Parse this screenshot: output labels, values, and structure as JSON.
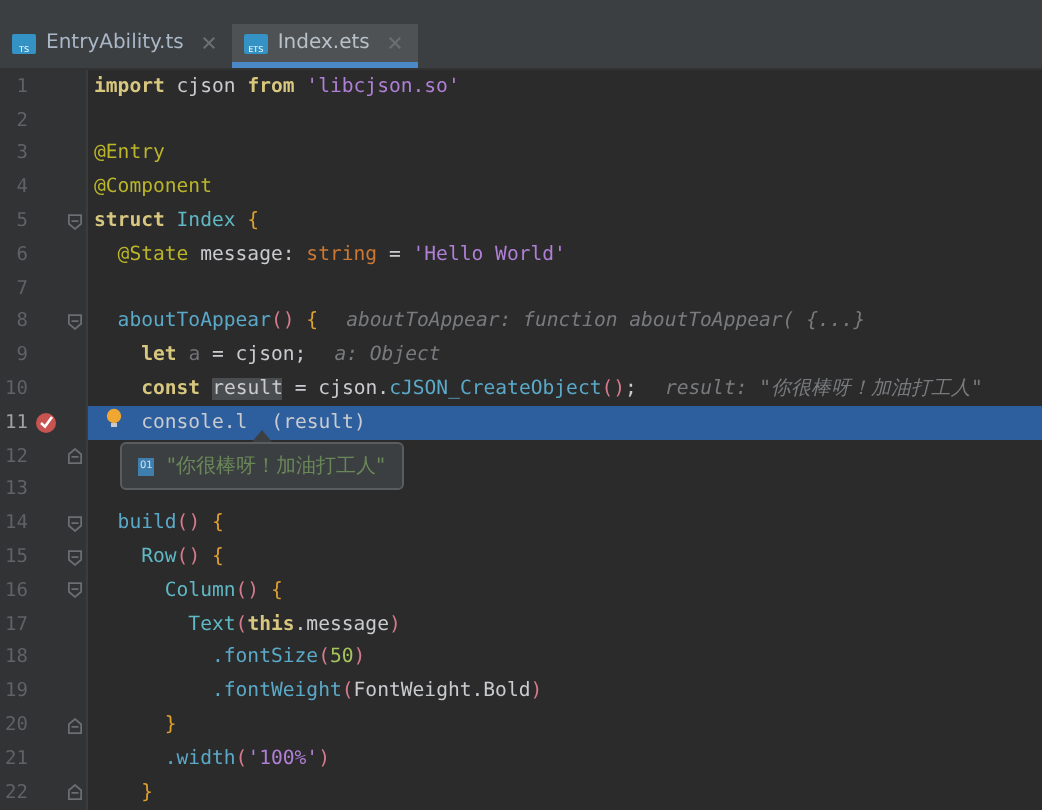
{
  "tabs": [
    {
      "label": "EntryAbility.ts",
      "icon": "TS",
      "selected": false
    },
    {
      "label": "Index.ets",
      "icon": "ETS",
      "selected": true
    }
  ],
  "lines": [
    {
      "number": "1",
      "tokens": [
        {
          "kind": "kw",
          "t": "import"
        },
        {
          "kind": "plain",
          "t": " cjson "
        },
        {
          "kind": "kw",
          "t": "from"
        },
        {
          "kind": "str",
          "t": " 'libcjson.so'"
        }
      ]
    },
    {
      "number": "2"
    },
    {
      "number": "3",
      "tokens": [
        {
          "kind": "dec",
          "t": "@Entry"
        }
      ]
    },
    {
      "number": "4",
      "tokens": [
        {
          "kind": "dec",
          "t": "@Component"
        }
      ]
    },
    {
      "number": "5",
      "fold_start": true,
      "tokens": [
        {
          "kind": "kw",
          "t": "struct"
        },
        {
          "kind": "cls",
          "t": " Index"
        },
        {
          "kind": "brace",
          "t": " {"
        }
      ]
    },
    {
      "number": "6",
      "tokens": [
        {
          "kind": "dec",
          "t": "  @State"
        },
        {
          "kind": "plain",
          "t": " message: "
        },
        {
          "kind": "type",
          "t": "string"
        },
        {
          "kind": "plain",
          "t": " = "
        },
        {
          "kind": "str",
          "t": "'Hello World'"
        }
      ]
    },
    {
      "number": "7"
    },
    {
      "number": "8",
      "fold_start": true,
      "tokens": [
        {
          "kind": "fn",
          "t": "  aboutToAppear"
        },
        {
          "kind": "paren",
          "t": "()"
        },
        {
          "kind": "brace",
          "t": " {"
        }
      ],
      "hint": "aboutToAppear: function aboutToAppear( {...}"
    },
    {
      "number": "9",
      "tokens": [
        {
          "kind": "kw",
          "t": "    let"
        },
        {
          "kind": "unused",
          "t": " a"
        },
        {
          "kind": "plain",
          "t": " = cjson;"
        }
      ],
      "hint": "a: Object"
    },
    {
      "number": "10",
      "tokens": [
        {
          "kind": "kw",
          "t": "    const"
        },
        {
          "kind": "mark",
          "t": "result"
        },
        {
          "kind": "plain",
          "t": " = cjson."
        },
        {
          "kind": "fn",
          "t": "cJSON_CreateObject"
        },
        {
          "kind": "paren",
          "t": "()"
        },
        {
          "kind": "plain",
          "t": ";"
        }
      ],
      "hint": "result: \"你很棒呀！加油打工人\""
    },
    {
      "number": "11",
      "current": true,
      "breakpoint": true,
      "bulb": true,
      "tokens": [
        {
          "kind": "plain",
          "t": "console.l"
        },
        {
          "kind": "plain",
          "t": "(result)",
          "spaced": true
        }
      ]
    },
    {
      "number": "12",
      "fold_end": true
    },
    {
      "number": "13"
    },
    {
      "number": "14",
      "fold_start": true,
      "tokens": [
        {
          "kind": "fn",
          "t": "  build"
        },
        {
          "kind": "paren",
          "t": "()"
        },
        {
          "kind": "brace",
          "t": " {"
        }
      ]
    },
    {
      "number": "15",
      "fold_start": true,
      "tokens": [
        {
          "kind": "cls",
          "t": "    Row"
        },
        {
          "kind": "paren",
          "t": "()"
        },
        {
          "kind": "brace",
          "t": " {"
        }
      ]
    },
    {
      "number": "16",
      "fold_start": true,
      "tokens": [
        {
          "kind": "cls",
          "t": "      Column"
        },
        {
          "kind": "paren",
          "t": "()"
        },
        {
          "kind": "brace",
          "t": " {"
        }
      ]
    },
    {
      "number": "17",
      "tokens": [
        {
          "kind": "cls",
          "t": "        Text"
        },
        {
          "kind": "paren",
          "t": "("
        },
        {
          "kind": "kw",
          "t": "this"
        },
        {
          "kind": "plain",
          "t": ".message"
        },
        {
          "kind": "paren",
          "t": ")"
        }
      ]
    },
    {
      "number": "18",
      "tokens": [
        {
          "kind": "fn",
          "t": "          .fontSize"
        },
        {
          "kind": "paren",
          "t": "("
        },
        {
          "kind": "num",
          "t": "50"
        },
        {
          "kind": "paren",
          "t": ")"
        }
      ]
    },
    {
      "number": "19",
      "tokens": [
        {
          "kind": "fn",
          "t": "          .fontWeight"
        },
        {
          "kind": "paren",
          "t": "("
        },
        {
          "kind": "plain",
          "t": "FontWeight.Bold"
        },
        {
          "kind": "paren",
          "t": ")"
        }
      ]
    },
    {
      "number": "20",
      "fold_end": true,
      "tokens": [
        {
          "kind": "brace",
          "t": "      }"
        }
      ]
    },
    {
      "number": "21",
      "tokens": [
        {
          "kind": "fn",
          "t": "      .width"
        },
        {
          "kind": "paren",
          "t": "("
        },
        {
          "kind": "str",
          "t": "'100%'"
        },
        {
          "kind": "paren",
          "t": ")"
        }
      ]
    },
    {
      "number": "22",
      "fold_end": true,
      "tokens": [
        {
          "kind": "brace",
          "t": "    }"
        }
      ]
    }
  ],
  "tooltip": {
    "badge": "01",
    "value": "\"你很棒呀！加油打工人\""
  }
}
